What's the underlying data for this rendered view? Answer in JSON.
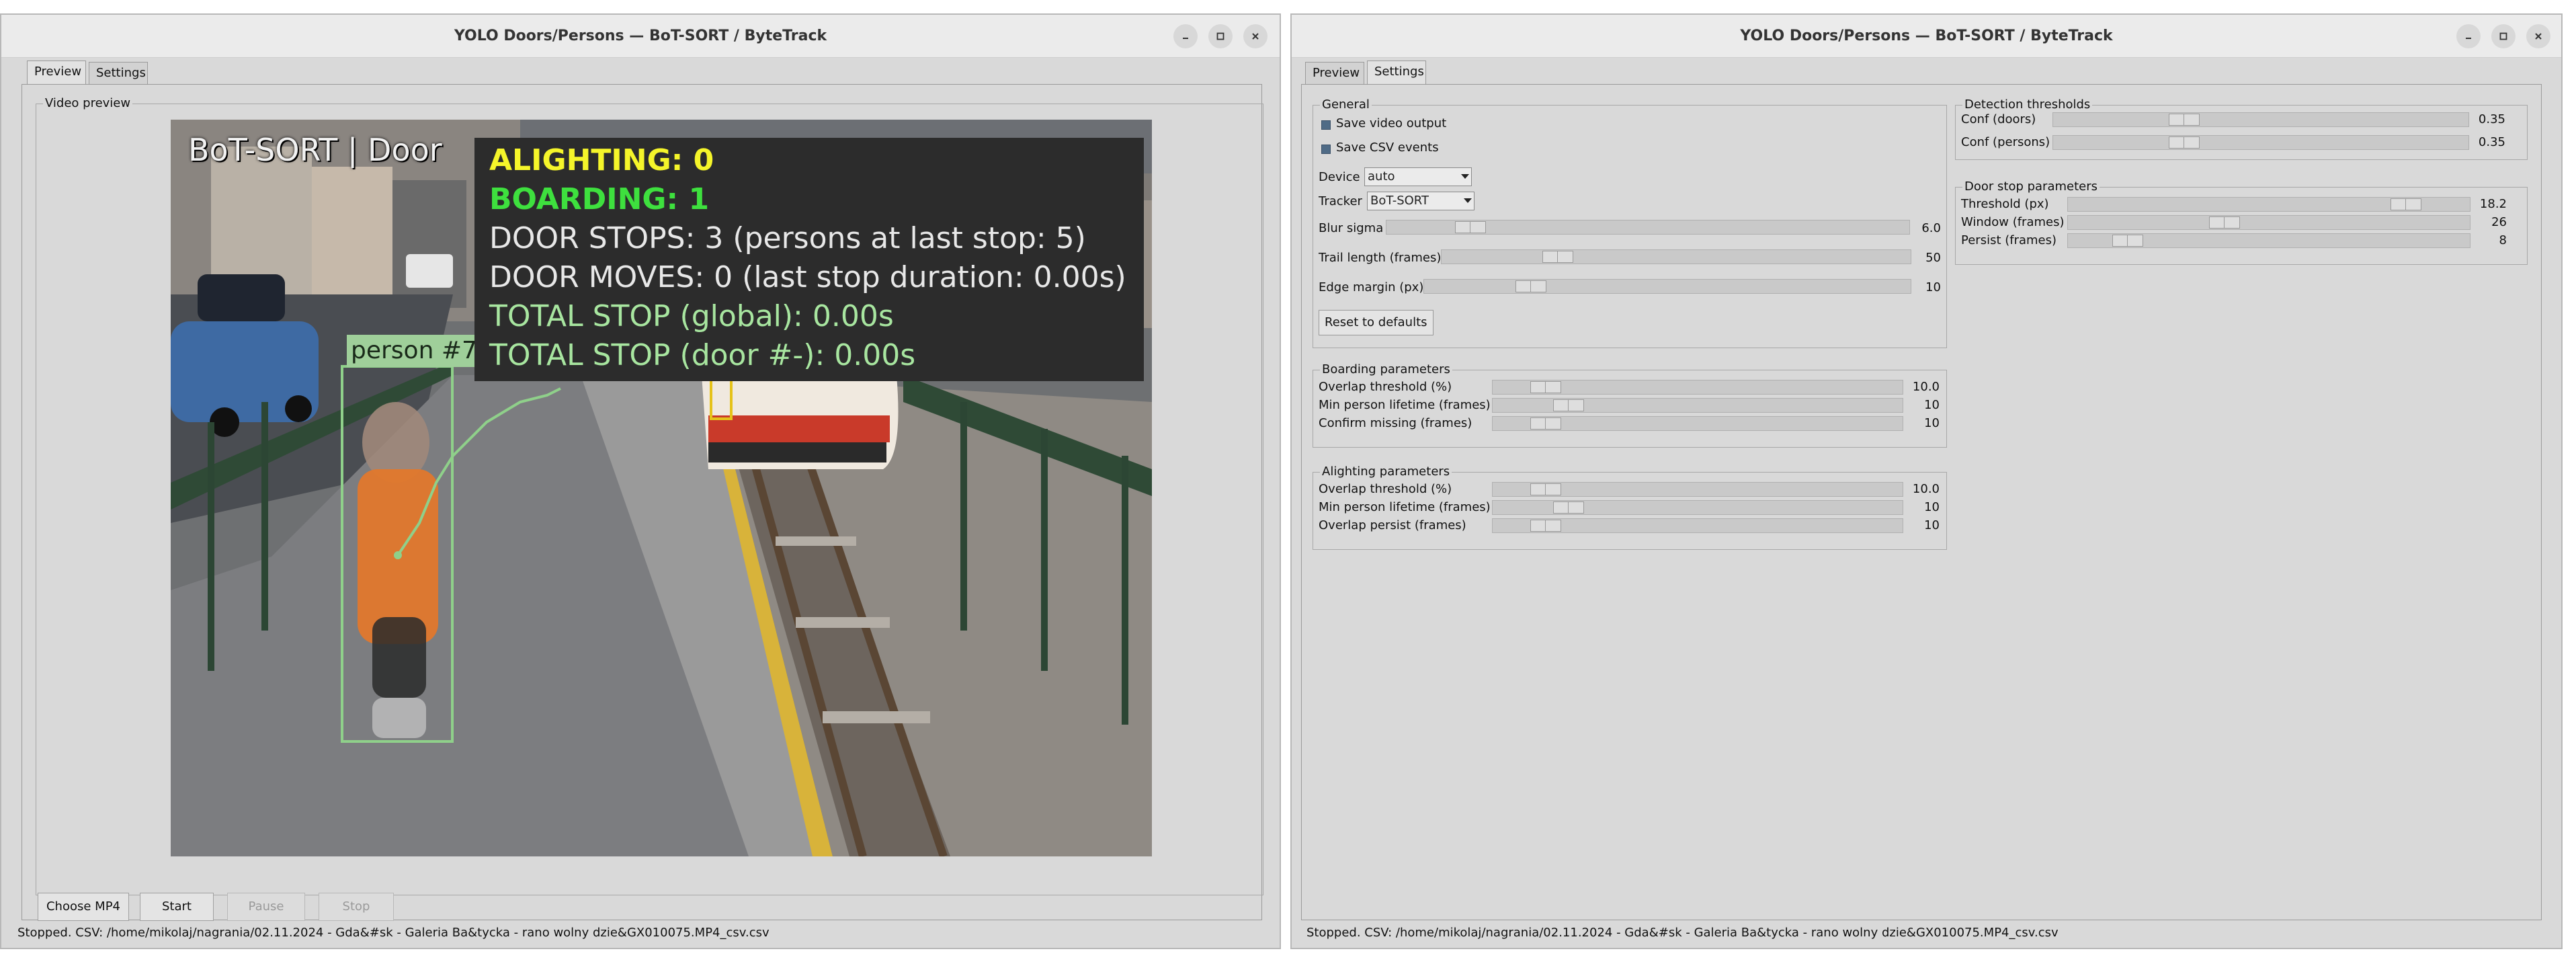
{
  "app_title": "YOLO Doors/Persons — BoT-SORT / ByteTrack",
  "tabs": [
    "Preview",
    "Settings"
  ],
  "left": {
    "video_frame_label": "Video preview",
    "overlay": {
      "hud_title": "BoT-SORT | Door",
      "alighting": "ALIGHTING: 0",
      "boarding": "BOARDING: 1",
      "door_stops": "DOOR STOPS: 3 (persons at last stop: 5)",
      "door_moves": "DOOR MOVES: 0 (last stop duration: 0.00s)",
      "total_stop_global": "TOTAL STOP (global): 0.00s",
      "total_stop_door": "TOTAL STOP (door #-): 0.00s",
      "person_label": "person #7",
      "colors": {
        "alighting": "#f5f52a",
        "boarding": "#3ee03e",
        "neutral": "#e8e8e8",
        "green_soft": "#a8e6a0",
        "box": "#8fd08a"
      }
    },
    "buttons": {
      "choose": "Choose MP4",
      "start": "Start",
      "pause": "Pause",
      "stop": "Stop"
    },
    "status": "Stopped. CSV: /home/mikolaj/nagrania/02.11.2024 - Gda&#sk - Galeria Ba&tycka - rano wolny dzie&GX010075.MP4_csv.csv"
  },
  "right": {
    "general": {
      "label": "General",
      "save_video": "Save video output",
      "save_csv": "Save CSV events",
      "device_label": "Device",
      "device_value": "auto",
      "tracker_label": "Tracker",
      "tracker_value": "BoT-SORT",
      "blur_label": "Blur sigma",
      "blur_value": "6.0",
      "blur_level": 0.14,
      "trail_label": "Trail length (frames)",
      "trail_value": "50",
      "trail_level": 0.23,
      "edge_label": "Edge margin (px)",
      "edge_value": "10",
      "edge_level": 0.2,
      "reset": "Reset to defaults"
    },
    "boarding": {
      "label": "Boarding parameters",
      "rows": [
        {
          "label": "Overlap threshold (%)",
          "value": "10.0",
          "level": 0.1
        },
        {
          "label": "Min person lifetime (frames)",
          "value": "10",
          "level": 0.16
        },
        {
          "label": "Confirm missing (frames)",
          "value": "10",
          "level": 0.1
        }
      ]
    },
    "alighting": {
      "label": "Alighting parameters",
      "rows": [
        {
          "label": "Overlap threshold (%)",
          "value": "10.0",
          "level": 0.1
        },
        {
          "label": "Min person lifetime (frames)",
          "value": "10",
          "level": 0.16
        },
        {
          "label": "Overlap persist (frames)",
          "value": "10",
          "level": 0.1
        }
      ]
    },
    "detection": {
      "label": "Detection thresholds",
      "rows": [
        {
          "label": "Conf (doors)",
          "value": "0.35",
          "level": 0.3
        },
        {
          "label": "Conf (persons)",
          "value": "0.35",
          "level": 0.3
        }
      ]
    },
    "doorstop": {
      "label": "Door stop parameters",
      "rows": [
        {
          "label": "Threshold (px)",
          "value": "18.2",
          "level": 0.87
        },
        {
          "label": "Window (frames)",
          "value": "26",
          "level": 0.38
        },
        {
          "label": "Persist (frames)",
          "value": "8",
          "level": 0.12
        }
      ]
    },
    "status": "Stopped. CSV: /home/mikolaj/nagrania/02.11.2024 - Gda&#sk - Galeria Ba&tycka - rano wolny dzie&GX010075.MP4_csv.csv"
  }
}
